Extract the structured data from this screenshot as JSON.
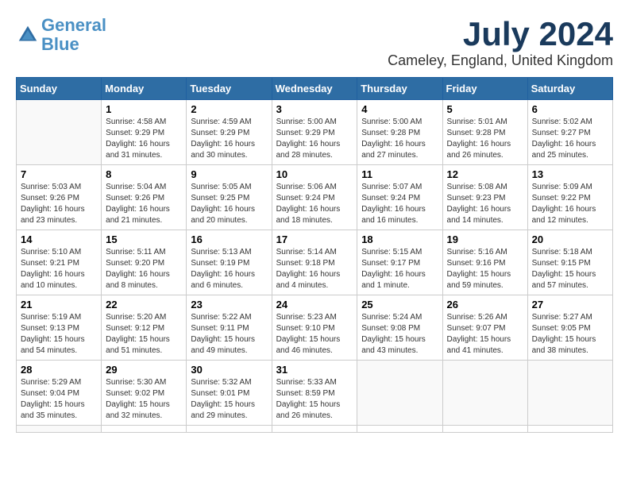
{
  "logo": {
    "line1": "General",
    "line2": "Blue"
  },
  "title": "July 2024",
  "location": "Cameley, England, United Kingdom",
  "weekdays": [
    "Sunday",
    "Monday",
    "Tuesday",
    "Wednesday",
    "Thursday",
    "Friday",
    "Saturday"
  ],
  "days": [
    {
      "num": "",
      "info": ""
    },
    {
      "num": "1",
      "info": "Sunrise: 4:58 AM\nSunset: 9:29 PM\nDaylight: 16 hours\nand 31 minutes."
    },
    {
      "num": "2",
      "info": "Sunrise: 4:59 AM\nSunset: 9:29 PM\nDaylight: 16 hours\nand 30 minutes."
    },
    {
      "num": "3",
      "info": "Sunrise: 5:00 AM\nSunset: 9:29 PM\nDaylight: 16 hours\nand 28 minutes."
    },
    {
      "num": "4",
      "info": "Sunrise: 5:00 AM\nSunset: 9:28 PM\nDaylight: 16 hours\nand 27 minutes."
    },
    {
      "num": "5",
      "info": "Sunrise: 5:01 AM\nSunset: 9:28 PM\nDaylight: 16 hours\nand 26 minutes."
    },
    {
      "num": "6",
      "info": "Sunrise: 5:02 AM\nSunset: 9:27 PM\nDaylight: 16 hours\nand 25 minutes."
    },
    {
      "num": "7",
      "info": "Sunrise: 5:03 AM\nSunset: 9:26 PM\nDaylight: 16 hours\nand 23 minutes."
    },
    {
      "num": "8",
      "info": "Sunrise: 5:04 AM\nSunset: 9:26 PM\nDaylight: 16 hours\nand 21 minutes."
    },
    {
      "num": "9",
      "info": "Sunrise: 5:05 AM\nSunset: 9:25 PM\nDaylight: 16 hours\nand 20 minutes."
    },
    {
      "num": "10",
      "info": "Sunrise: 5:06 AM\nSunset: 9:24 PM\nDaylight: 16 hours\nand 18 minutes."
    },
    {
      "num": "11",
      "info": "Sunrise: 5:07 AM\nSunset: 9:24 PM\nDaylight: 16 hours\nand 16 minutes."
    },
    {
      "num": "12",
      "info": "Sunrise: 5:08 AM\nSunset: 9:23 PM\nDaylight: 16 hours\nand 14 minutes."
    },
    {
      "num": "13",
      "info": "Sunrise: 5:09 AM\nSunset: 9:22 PM\nDaylight: 16 hours\nand 12 minutes."
    },
    {
      "num": "14",
      "info": "Sunrise: 5:10 AM\nSunset: 9:21 PM\nDaylight: 16 hours\nand 10 minutes."
    },
    {
      "num": "15",
      "info": "Sunrise: 5:11 AM\nSunset: 9:20 PM\nDaylight: 16 hours\nand 8 minutes."
    },
    {
      "num": "16",
      "info": "Sunrise: 5:13 AM\nSunset: 9:19 PM\nDaylight: 16 hours\nand 6 minutes."
    },
    {
      "num": "17",
      "info": "Sunrise: 5:14 AM\nSunset: 9:18 PM\nDaylight: 16 hours\nand 4 minutes."
    },
    {
      "num": "18",
      "info": "Sunrise: 5:15 AM\nSunset: 9:17 PM\nDaylight: 16 hours\nand 1 minute."
    },
    {
      "num": "19",
      "info": "Sunrise: 5:16 AM\nSunset: 9:16 PM\nDaylight: 15 hours\nand 59 minutes."
    },
    {
      "num": "20",
      "info": "Sunrise: 5:18 AM\nSunset: 9:15 PM\nDaylight: 15 hours\nand 57 minutes."
    },
    {
      "num": "21",
      "info": "Sunrise: 5:19 AM\nSunset: 9:13 PM\nDaylight: 15 hours\nand 54 minutes."
    },
    {
      "num": "22",
      "info": "Sunrise: 5:20 AM\nSunset: 9:12 PM\nDaylight: 15 hours\nand 51 minutes."
    },
    {
      "num": "23",
      "info": "Sunrise: 5:22 AM\nSunset: 9:11 PM\nDaylight: 15 hours\nand 49 minutes."
    },
    {
      "num": "24",
      "info": "Sunrise: 5:23 AM\nSunset: 9:10 PM\nDaylight: 15 hours\nand 46 minutes."
    },
    {
      "num": "25",
      "info": "Sunrise: 5:24 AM\nSunset: 9:08 PM\nDaylight: 15 hours\nand 43 minutes."
    },
    {
      "num": "26",
      "info": "Sunrise: 5:26 AM\nSunset: 9:07 PM\nDaylight: 15 hours\nand 41 minutes."
    },
    {
      "num": "27",
      "info": "Sunrise: 5:27 AM\nSunset: 9:05 PM\nDaylight: 15 hours\nand 38 minutes."
    },
    {
      "num": "28",
      "info": "Sunrise: 5:29 AM\nSunset: 9:04 PM\nDaylight: 15 hours\nand 35 minutes."
    },
    {
      "num": "29",
      "info": "Sunrise: 5:30 AM\nSunset: 9:02 PM\nDaylight: 15 hours\nand 32 minutes."
    },
    {
      "num": "30",
      "info": "Sunrise: 5:32 AM\nSunset: 9:01 PM\nDaylight: 15 hours\nand 29 minutes."
    },
    {
      "num": "31",
      "info": "Sunrise: 5:33 AM\nSunset: 8:59 PM\nDaylight: 15 hours\nand 26 minutes."
    },
    {
      "num": "",
      "info": ""
    },
    {
      "num": "",
      "info": ""
    },
    {
      "num": "",
      "info": ""
    },
    {
      "num": "",
      "info": ""
    }
  ]
}
